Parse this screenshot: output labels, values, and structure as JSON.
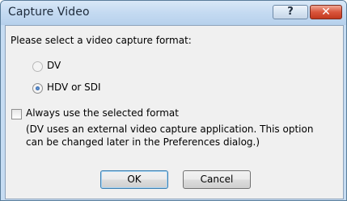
{
  "window": {
    "title": "Capture Video",
    "help_glyph": "?",
    "close_glyph": "✕"
  },
  "prompt": "Please select a video capture format:",
  "formats": [
    {
      "label": "DV",
      "selected": false,
      "enabled": false
    },
    {
      "label": "HDV or SDI",
      "selected": true,
      "enabled": true
    }
  ],
  "always_use": {
    "label": "Always use the selected format",
    "checked": false
  },
  "note": {
    "line1": "(DV uses an external video capture application. This option",
    "line2": "can be changed later in the Preferences dialog.)"
  },
  "buttons": {
    "ok": "OK",
    "cancel": "Cancel"
  },
  "colors": {
    "title_bar": "#c4daf1",
    "dialog_body": "#f0f0f0",
    "close_button": "#c2391f",
    "default_button_border": "#3c7fb1"
  }
}
